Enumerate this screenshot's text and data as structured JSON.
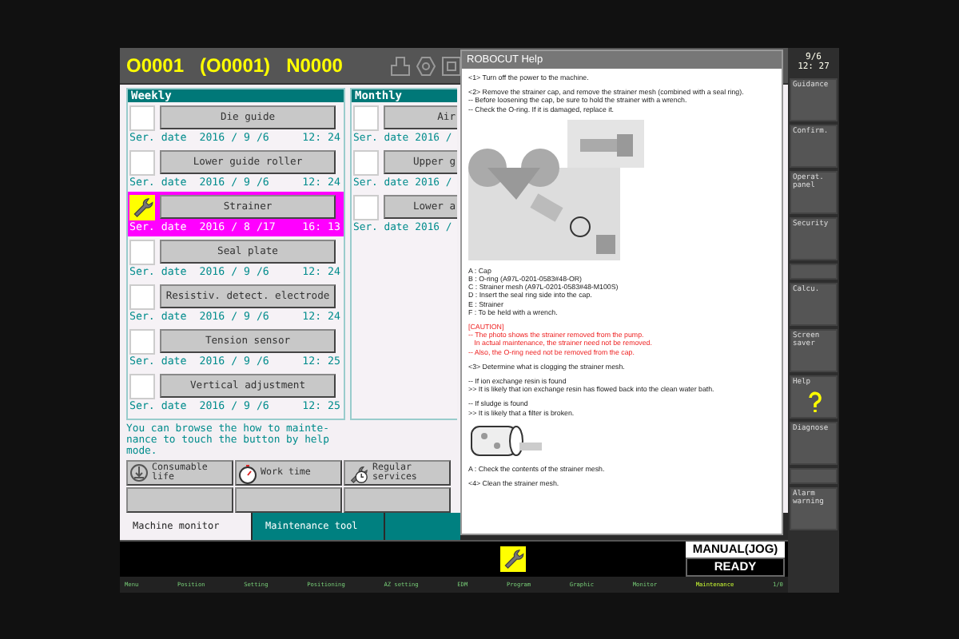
{
  "header": {
    "program": "O0001",
    "sub": "(O0001)",
    "sequence": "N0000"
  },
  "weekly": {
    "title": "Weekly",
    "items": [
      {
        "name": "Die guide",
        "label": "Ser. date",
        "date": "2016 / 9 /6",
        "time": "12: 24",
        "selected": false
      },
      {
        "name": "Lower guide roller",
        "label": "Ser. date",
        "date": "2016 / 9 /6",
        "time": "12: 24",
        "selected": false
      },
      {
        "name": "Strainer",
        "label": "Ser. date",
        "date": "2016 / 8 /17",
        "time": "16: 13",
        "selected": true
      },
      {
        "name": "Seal plate",
        "label": "Ser. date",
        "date": "2016 / 9 /6",
        "time": "12: 24",
        "selected": false
      },
      {
        "name": "Resistiv. detect. electrode",
        "label": "Ser. date",
        "date": "2016 / 9 /6",
        "time": "12: 24",
        "selected": false
      },
      {
        "name": "Tension sensor",
        "label": "Ser. date",
        "date": "2016 / 9 /6",
        "time": "12: 25",
        "selected": false
      },
      {
        "name": "Vertical adjustment",
        "label": "Ser. date",
        "date": "2016 / 9 /6",
        "time": "12: 25",
        "selected": false
      }
    ]
  },
  "monthly": {
    "title": "Monthly",
    "items": [
      {
        "name": "Air",
        "label": "Ser. date",
        "date": "2016 /",
        "selected": false
      },
      {
        "name": "Upper g",
        "label": "Ser. date",
        "date": "2016 /",
        "selected": false
      },
      {
        "name": "Lower a",
        "label": "Ser. date",
        "date": "2016 /",
        "selected": false
      }
    ]
  },
  "message": "You can browse the how to mainte-nance to touch the button by help mode.",
  "functions": [
    {
      "kind": "consumable",
      "label": "Consumable life"
    },
    {
      "kind": "worktime",
      "label": "Work time"
    },
    {
      "kind": "regular",
      "label": "Regular services"
    }
  ],
  "tabs": [
    {
      "label": "Machine monitor",
      "selected": true
    },
    {
      "label": "Maintenance tool",
      "selected": false
    }
  ],
  "status": {
    "mode": "MANUAL(JOG)",
    "state": "READY"
  },
  "menu": [
    {
      "label": "Menu",
      "selected": false
    },
    {
      "label": "Position",
      "selected": false
    },
    {
      "label": "Setting",
      "selected": false
    },
    {
      "label": "Positioning",
      "selected": false
    },
    {
      "label": "AZ setting",
      "selected": false
    },
    {
      "label": "EDM",
      "selected": false
    },
    {
      "label": "Program",
      "selected": false
    },
    {
      "label": "Graphic",
      "selected": false
    },
    {
      "label": "Monitor",
      "selected": false
    },
    {
      "label": "Maintenance",
      "selected": true
    },
    {
      "label": "1/0",
      "selected": false
    }
  ],
  "sidebar": {
    "date": "9/6",
    "time": "12: 27",
    "buttons": [
      {
        "kind": "button",
        "label": "Guidance"
      },
      {
        "kind": "button",
        "label": "Confirm."
      },
      {
        "kind": "button",
        "label": "Operat. panel"
      },
      {
        "kind": "button",
        "label": "Security"
      },
      {
        "kind": "blank"
      },
      {
        "kind": "button",
        "label": "Calcu."
      },
      {
        "kind": "button",
        "label": "Screen saver"
      },
      {
        "kind": "help",
        "label": "Help"
      },
      {
        "kind": "button",
        "label": "Diagnose"
      },
      {
        "kind": "blank"
      },
      {
        "kind": "button",
        "label": "Alarm warning"
      }
    ]
  },
  "help": {
    "title": "ROBOCUT Help",
    "blocks": [
      {
        "kind": "text",
        "lines": [
          "<1> Turn off the power to the machine."
        ]
      },
      {
        "kind": "text",
        "lines": [
          "<2> Remove the strainer cap, and remove the strainer mesh (combined with a seal ring).",
          "-- Before loosening the cap, be sure to hold the strainer with a wrench.",
          "-- Check the O-ring. If it is damaged, replace it."
        ]
      },
      {
        "kind": "picture"
      },
      {
        "kind": "text",
        "lines": [
          "A : Cap",
          "B : O-ring (A97L-0201-0583#48-OR)",
          "C : Strainer mesh (A97L-0201-0583#48-M100S)",
          "D : Insert the seal ring side into the cap.",
          "E : Strainer",
          "F : To be held with a wrench."
        ]
      },
      {
        "kind": "caution",
        "lines": [
          "[CAUTION]",
          "-- The photo shows the strainer removed from the pump.",
          "   In actual maintenance, the strainer need not be removed.",
          "-- Also, the O-ring need not be removed from the cap."
        ]
      },
      {
        "kind": "text",
        "lines": [
          "<3> Determine what is clogging the strainer mesh."
        ]
      },
      {
        "kind": "text",
        "lines": [
          "-- If ion exchange resin is found",
          ">> It is likely that ion exchange resin has flowed back into the clean water bath."
        ]
      },
      {
        "kind": "text",
        "lines": [
          "-- If sludge is found",
          ">> It is likely that a filter is broken."
        ]
      },
      {
        "kind": "picture"
      },
      {
        "kind": "text",
        "lines": [
          "A : Check the contents of the strainer mesh."
        ]
      },
      {
        "kind": "text",
        "lines": [
          "<4> Clean the strainer mesh."
        ]
      }
    ]
  }
}
